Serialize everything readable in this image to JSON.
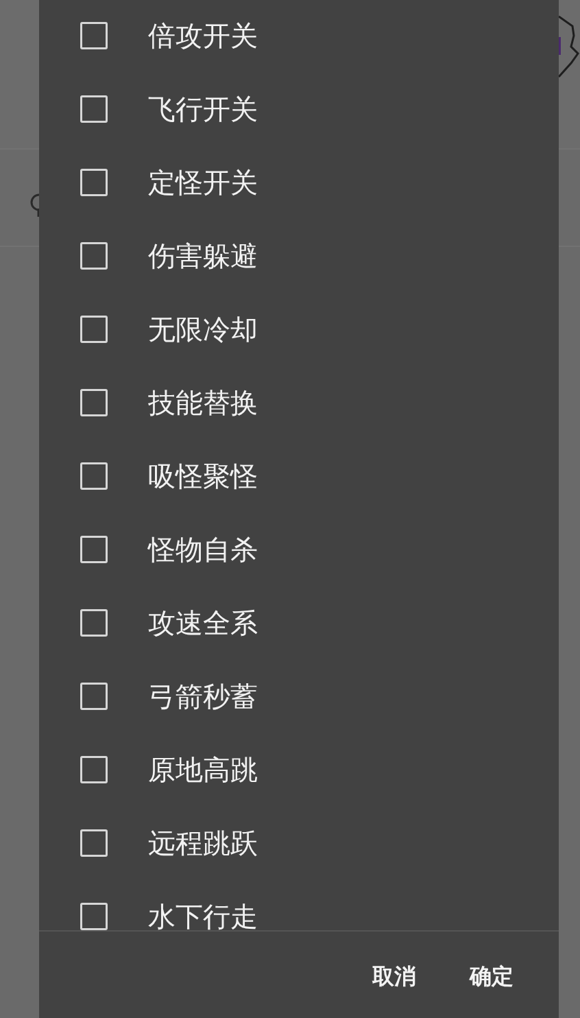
{
  "dialog": {
    "options": [
      {
        "label": "倍攻开关",
        "checked": false
      },
      {
        "label": "飞行开关",
        "checked": false
      },
      {
        "label": "定怪开关",
        "checked": false
      },
      {
        "label": "伤害躲避",
        "checked": false
      },
      {
        "label": "无限冷却",
        "checked": false
      },
      {
        "label": "技能替换",
        "checked": false
      },
      {
        "label": "吸怪聚怪",
        "checked": false
      },
      {
        "label": "怪物自杀",
        "checked": false
      },
      {
        "label": "攻速全系",
        "checked": false
      },
      {
        "label": "弓箭秒蓄",
        "checked": false
      },
      {
        "label": "原地高跳",
        "checked": false
      },
      {
        "label": "远程跳跃",
        "checked": false
      },
      {
        "label": "水下行走",
        "checked": false
      }
    ],
    "buttons": [
      "取消",
      "确定"
    ]
  }
}
